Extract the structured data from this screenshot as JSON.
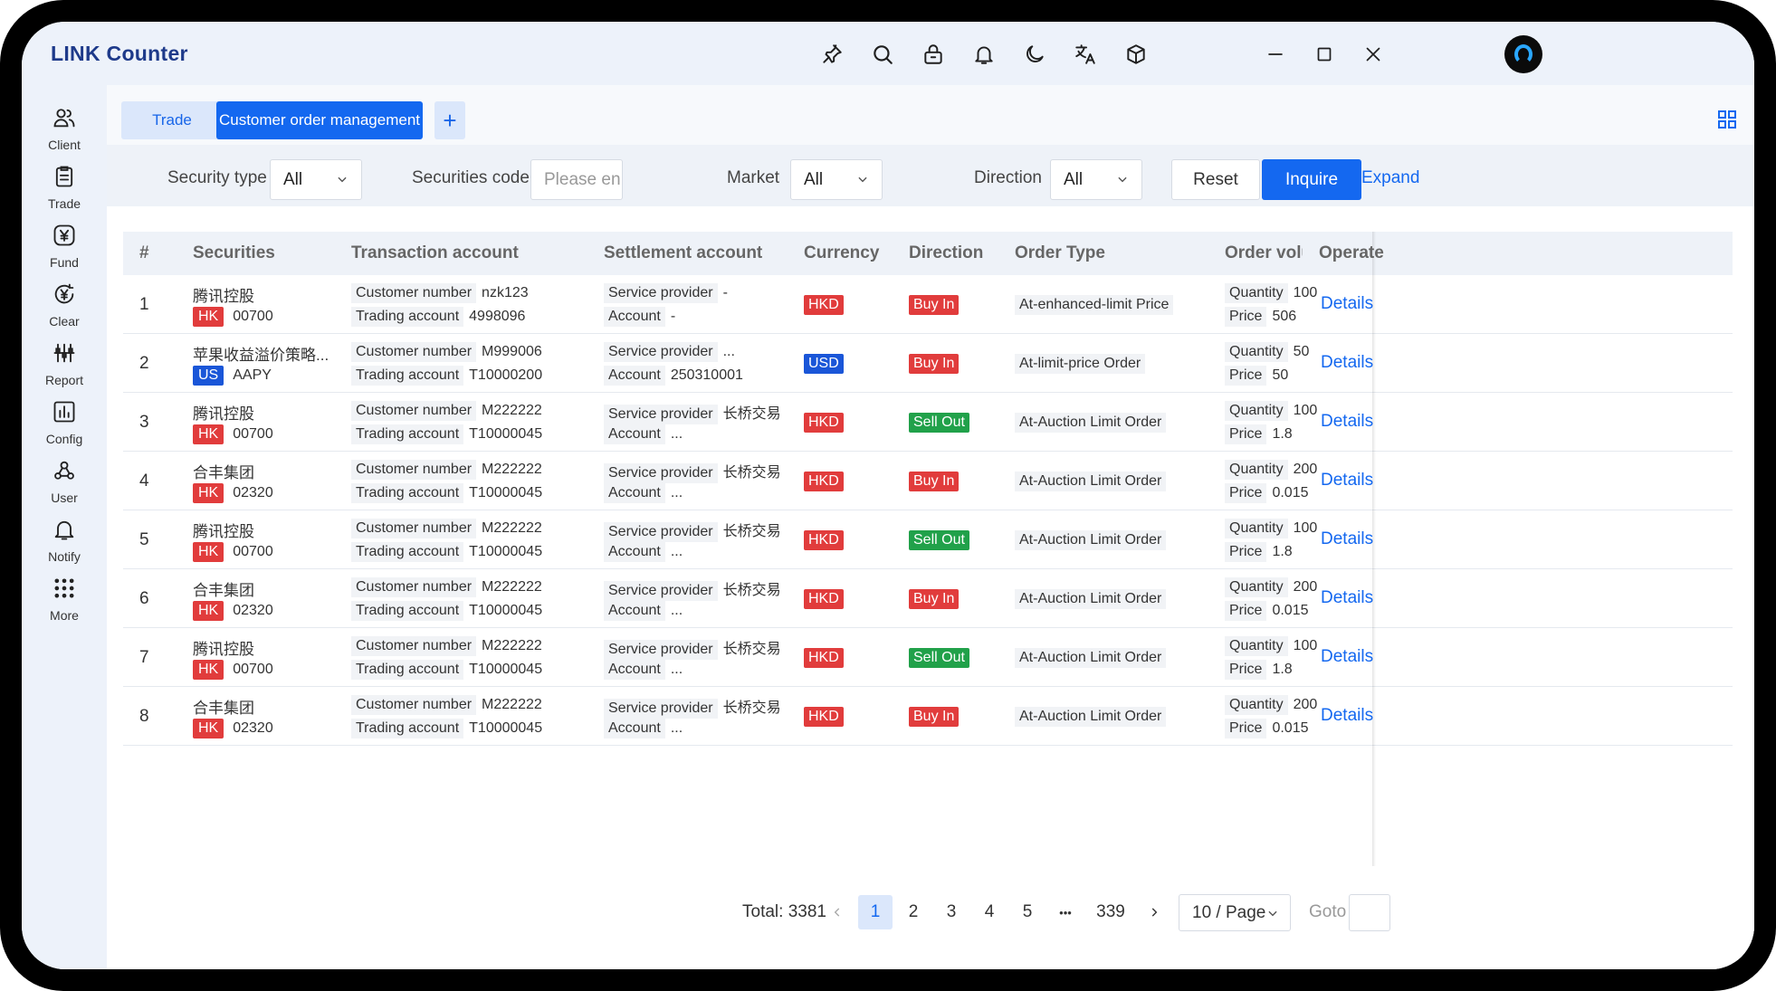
{
  "app": {
    "title": "LINK Counter"
  },
  "titlebar_icons": [
    "pin-icon",
    "search-icon",
    "lock-icon",
    "bell-icon",
    "moon-icon",
    "translate-icon",
    "box-icon"
  ],
  "window_controls": [
    "minimize-icon",
    "maximize-icon",
    "close-icon"
  ],
  "sidebar": {
    "items": [
      {
        "label": "Client",
        "icon": "users-icon"
      },
      {
        "label": "Trade",
        "icon": "clipboard-icon"
      },
      {
        "label": "Fund",
        "icon": "yen-icon"
      },
      {
        "label": "Clear",
        "icon": "yen-refresh-icon"
      },
      {
        "label": "Report",
        "icon": "sliders-icon"
      },
      {
        "label": "Config",
        "icon": "chart-config-icon"
      },
      {
        "label": "User",
        "icon": "user-network-icon"
      },
      {
        "label": "Notify",
        "icon": "bell-icon"
      },
      {
        "label": "More",
        "icon": "dots-grid-icon"
      }
    ]
  },
  "tabs": {
    "items": [
      {
        "label": "Trade"
      },
      {
        "label": "Customer order management"
      }
    ],
    "add_label": "+"
  },
  "filters": {
    "security_type": {
      "label": "Security type",
      "value": "All"
    },
    "securities_code": {
      "label": "Securities code",
      "placeholder": "Please en"
    },
    "market": {
      "label": "Market",
      "value": "All"
    },
    "direction": {
      "label": "Direction",
      "value": "All"
    },
    "reset_label": "Reset",
    "inquire_label": "Inquire",
    "expand_label": "Expand"
  },
  "table": {
    "columns": [
      "#",
      "Securities",
      "Transaction account",
      "Settlement account",
      "Currency",
      "Direction",
      "Order Type",
      "Order volu",
      "Operate"
    ],
    "labels": {
      "customer_number": "Customer number",
      "trading_account": "Trading account",
      "service_provider": "Service provider",
      "account": "Account",
      "quantity": "Quantity",
      "price": "Price",
      "details": "Details"
    },
    "rows": [
      {
        "num": "1",
        "name": "腾讯控股",
        "market": "HK",
        "code": "00700",
        "customer_number": "nzk123",
        "trading_account": "4998096",
        "service_provider": "-",
        "account": "-",
        "currency": "HKD",
        "direction": "Buy In",
        "order_type": "At-enhanced-limit Price",
        "quantity": "100",
        "price": "506"
      },
      {
        "num": "2",
        "name": "苹果收益溢价策略...",
        "market": "US",
        "code": "AAPY",
        "customer_number": "M999006",
        "trading_account": "T10000200",
        "service_provider": "...",
        "account": "250310001",
        "currency": "USD",
        "direction": "Buy In",
        "order_type": "At-limit-price Order",
        "quantity": "50",
        "price": "50"
      },
      {
        "num": "3",
        "name": "腾讯控股",
        "market": "HK",
        "code": "00700",
        "customer_number": "M222222",
        "trading_account": "T10000045",
        "service_provider": "长桥交易",
        "account": "...",
        "currency": "HKD",
        "direction": "Sell Out",
        "order_type": "At-Auction Limit Order",
        "quantity": "100",
        "price": "1.8"
      },
      {
        "num": "4",
        "name": "合丰集团",
        "market": "HK",
        "code": "02320",
        "customer_number": "M222222",
        "trading_account": "T10000045",
        "service_provider": "长桥交易",
        "account": "...",
        "currency": "HKD",
        "direction": "Buy In",
        "order_type": "At-Auction Limit Order",
        "quantity": "200",
        "price": "0.015"
      },
      {
        "num": "5",
        "name": "腾讯控股",
        "market": "HK",
        "code": "00700",
        "customer_number": "M222222",
        "trading_account": "T10000045",
        "service_provider": "长桥交易",
        "account": "...",
        "currency": "HKD",
        "direction": "Sell Out",
        "order_type": "At-Auction Limit Order",
        "quantity": "100",
        "price": "1.8"
      },
      {
        "num": "6",
        "name": "合丰集团",
        "market": "HK",
        "code": "02320",
        "customer_number": "M222222",
        "trading_account": "T10000045",
        "service_provider": "长桥交易",
        "account": "...",
        "currency": "HKD",
        "direction": "Buy In",
        "order_type": "At-Auction Limit Order",
        "quantity": "200",
        "price": "0.015"
      },
      {
        "num": "7",
        "name": "腾讯控股",
        "market": "HK",
        "code": "00700",
        "customer_number": "M222222",
        "trading_account": "T10000045",
        "service_provider": "长桥交易",
        "account": "...",
        "currency": "HKD",
        "direction": "Sell Out",
        "order_type": "At-Auction Limit Order",
        "quantity": "100",
        "price": "1.8"
      },
      {
        "num": "8",
        "name": "合丰集团",
        "market": "HK",
        "code": "02320",
        "customer_number": "M222222",
        "trading_account": "T10000045",
        "service_provider": "长桥交易",
        "account": "...",
        "currency": "HKD",
        "direction": "Buy In",
        "order_type": "At-Auction Limit Order",
        "quantity": "200",
        "price": "0.015"
      }
    ]
  },
  "pagination": {
    "total_label": "Total: 3381",
    "pages": [
      "1",
      "2",
      "3",
      "4",
      "5",
      "•••",
      "339"
    ],
    "current": "1",
    "page_size": "10 / Page",
    "goto_label": "Goto"
  },
  "colors": {
    "primary": "#1468f0",
    "buy": "#e13c3c",
    "sell": "#21a14a",
    "us_market": "#1a56d8"
  }
}
